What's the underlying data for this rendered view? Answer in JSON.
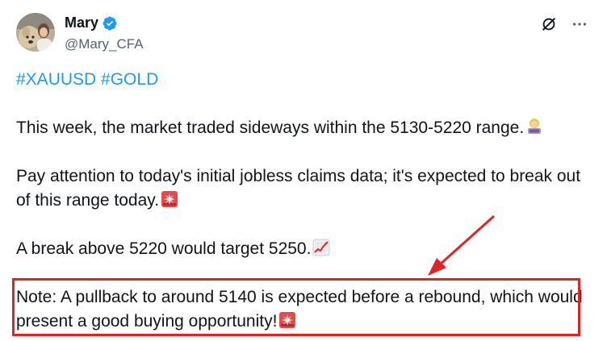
{
  "author": {
    "display_name": "Mary",
    "handle": "@Mary_CFA",
    "verified_icon": "verified-badge-icon"
  },
  "actions": {
    "grok_icon": "grok-slash-icon",
    "more_icon": "more-dots-icon",
    "more_label": "···"
  },
  "tweet": {
    "hashtag_1": "#XAUUSD",
    "hashtag_2": "#GOLD",
    "para_1": "This week, the market traded sideways within the 5130-5220 range.",
    "para_2": "Pay attention to today's initial jobless claims data; it's expected to break out of this range today.",
    "para_3": "A break above 5220 would target 5250.",
    "para_4": "Note: A pullback to around 5140 is expected before a rebound, which would present a good buying opportunity!",
    "emoji_1": "woman-technologist-icon",
    "emoji_2": "rotating-light-icon",
    "emoji_3": "chart-increasing-icon",
    "emoji_4": "rotating-light-icon"
  },
  "colors": {
    "link": "#1d9bf0",
    "text": "#0f1419",
    "secondary": "#536471",
    "annotation": "#e02424"
  }
}
